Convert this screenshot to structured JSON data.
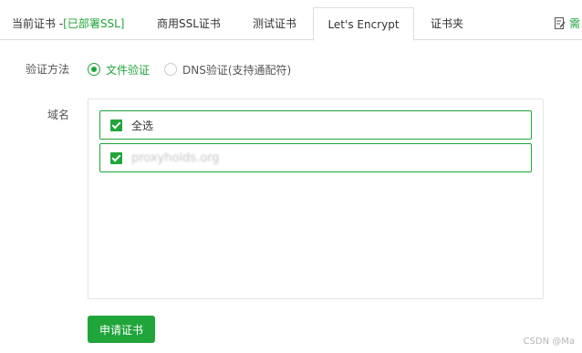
{
  "tabs": {
    "current_prefix": "当前证书 -",
    "current_status": "[已部署SSL]",
    "commercial": "商用SSL证书",
    "test": "测试证书",
    "letsencrypt": "Let's Encrypt",
    "folder": "证书夹",
    "more": "需"
  },
  "verification": {
    "label": "验证方法",
    "file": "文件验证",
    "dns": "DNS验证(支持通配符)",
    "selected": "文件验证"
  },
  "domains": {
    "label": "域名",
    "select_all": "全选",
    "items": [
      {
        "name": "proxyholds.org",
        "checked": true
      }
    ]
  },
  "apply_button": "申请证书",
  "watermark": "CSDN @Ma",
  "colors": {
    "accent": "#20a53a",
    "border": "#dddddd"
  }
}
